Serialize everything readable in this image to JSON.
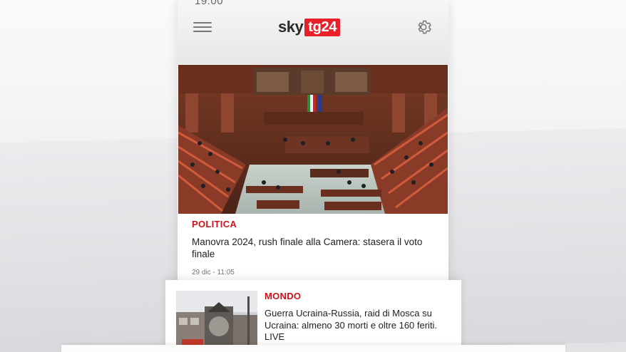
{
  "status_bar": {
    "time": "19:00"
  },
  "header": {
    "logo_sky": "sky",
    "logo_tg": "tg24",
    "menu_icon": "hamburger-menu-icon",
    "settings_icon": "gear-icon"
  },
  "articles": [
    {
      "category": "POLITICA",
      "headline": "Manovra 2024, rush finale alla Camera: stasera il voto finale",
      "timestamp": "29 dic - 11:05"
    },
    {
      "category": "MONDO",
      "headline": "Guerra Ucraina-Russia, raid di Mosca su Ucraina: almeno 30 morti e oltre 160 feriti. LIVE"
    }
  ],
  "colors": {
    "brand_red": "#e8202a",
    "category_red": "#d1121b",
    "text_dark": "#222222"
  }
}
